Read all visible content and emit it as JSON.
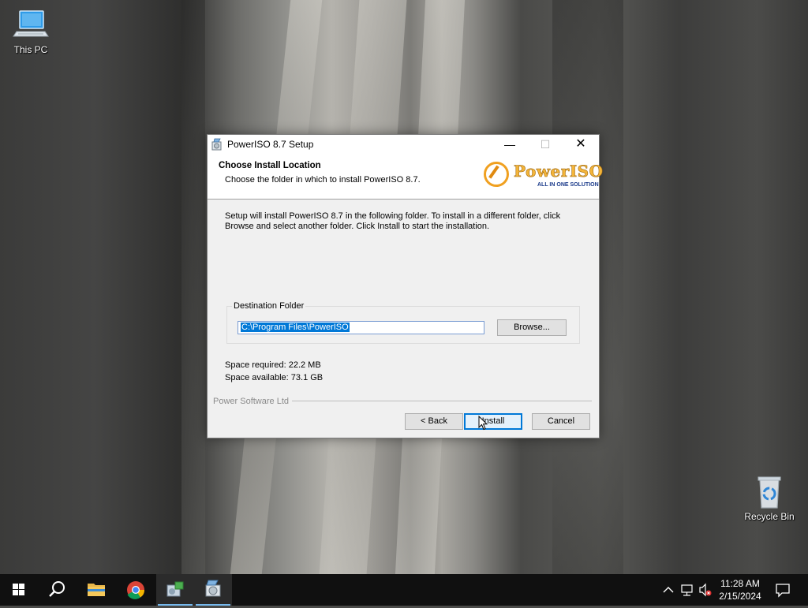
{
  "desktop": {
    "icons": [
      {
        "label": "This PC"
      },
      {
        "label": "Recycle Bin"
      }
    ]
  },
  "dialog": {
    "title": "PowerISO 8.7 Setup",
    "header": {
      "title": "Choose Install Location",
      "subtitle": "Choose the folder in which to install PowerISO 8.7.",
      "logo_text": "PowerISO",
      "logo_tagline": "ALL IN ONE SOLUTION"
    },
    "description": "Setup will install PowerISO 8.7 in the following folder. To install in a different folder, click Browse and select another folder. Click Install to start the installation.",
    "destination": {
      "group_label": "Destination Folder",
      "path": "C:\\Program Files\\PowerISO",
      "browse_label": "Browse..."
    },
    "space_required": "Space required: 22.2 MB",
    "space_available": "Space available: 73.1 GB",
    "brand": "Power Software Ltd",
    "buttons": {
      "back": "< Back",
      "install": "Install",
      "cancel": "Cancel"
    }
  },
  "taskbar": {
    "apps": [
      "start",
      "search",
      "file-explorer",
      "chrome",
      "network-app",
      "poweriso-setup"
    ],
    "active_app": "poweriso-setup",
    "clock": {
      "time": "11:28 AM",
      "date": "2/15/2024"
    }
  },
  "colors": {
    "accent": "#0078d7",
    "taskbar": "#101010",
    "dialog_bg": "#f0f0f0",
    "logo_orange": "#f4b53a"
  }
}
